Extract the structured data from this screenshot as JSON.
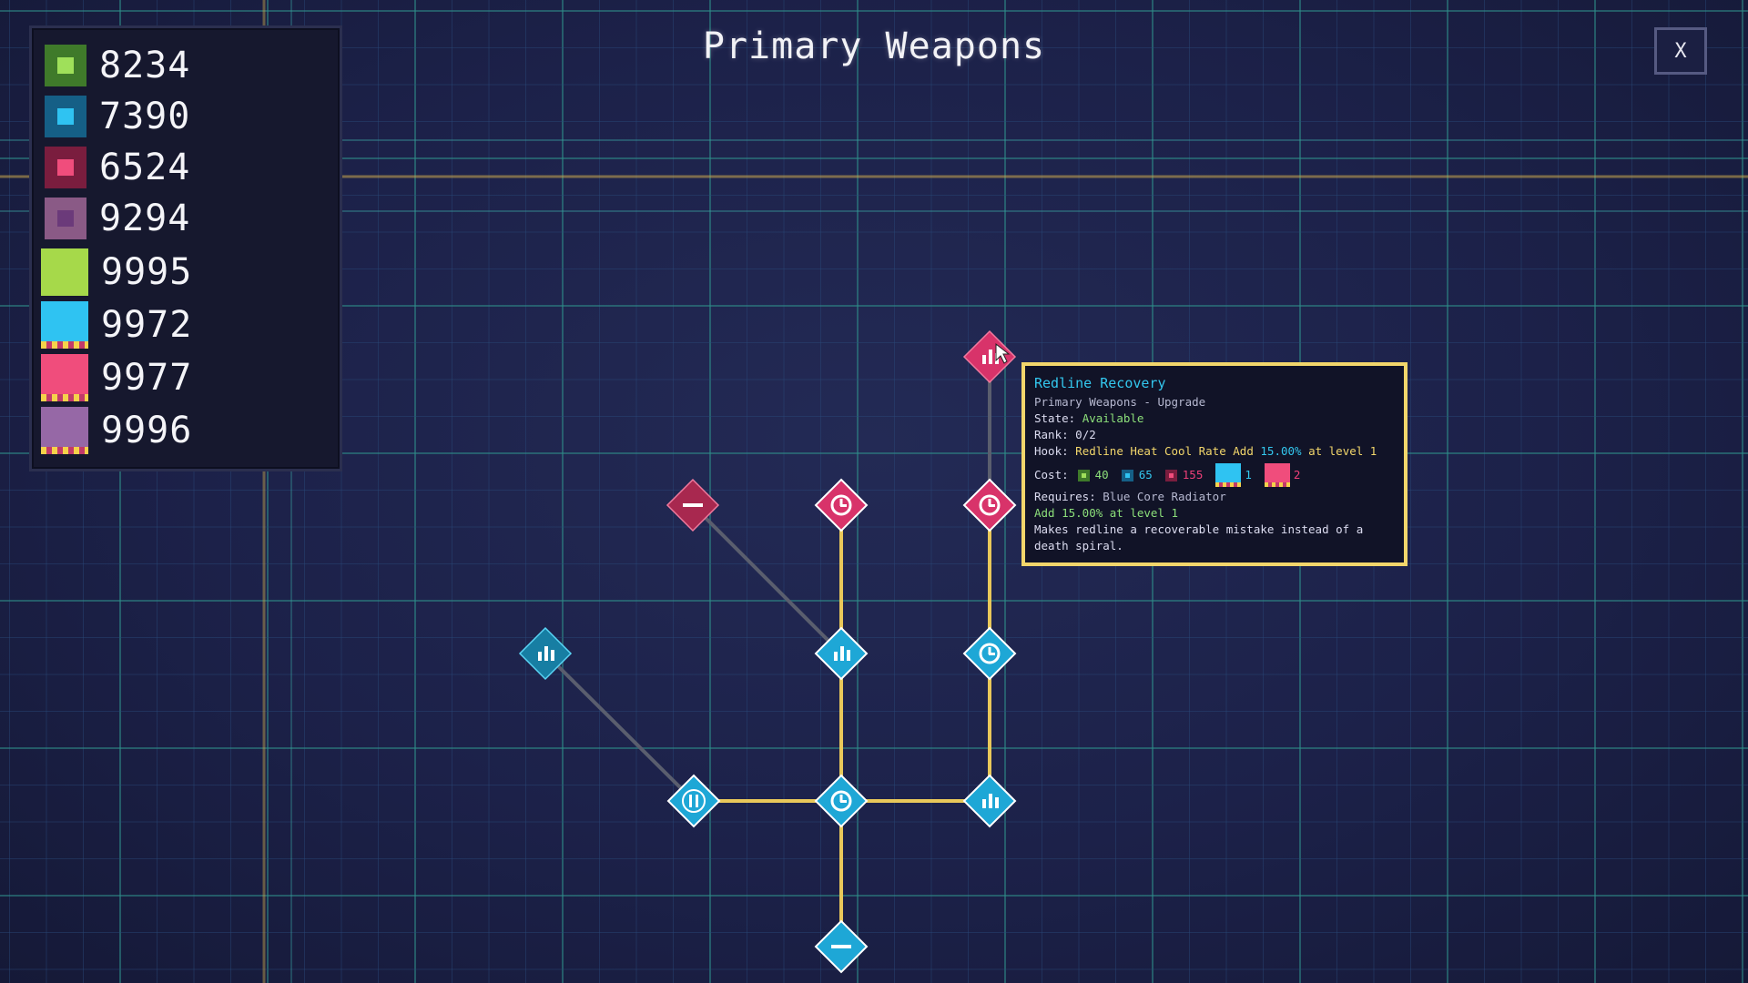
{
  "screen": {
    "title": "Primary Weapons",
    "close_label": "X"
  },
  "colors": {
    "cyan": "#1ea7d6",
    "pink": "#d8336a",
    "gold_link": "#e9c85a",
    "gray_link": "#5a5e6e",
    "tooltip_border": "#f2d66b"
  },
  "resources": [
    {
      "name": "green-shard",
      "icon": "small-green-cube",
      "value": "8234",
      "color": "#7bc043"
    },
    {
      "name": "blue-shard",
      "icon": "small-blue-cube",
      "value": "7390",
      "color": "#1ea7d6"
    },
    {
      "name": "red-shard",
      "icon": "small-red-cube",
      "value": "6524",
      "color": "#d8336a"
    },
    {
      "name": "purple-shard",
      "icon": "small-purple-cube",
      "value": "9294",
      "color": "#a86aa8"
    },
    {
      "name": "green-core",
      "icon": "large-green-core",
      "value": "9995",
      "color": "#a6d94a"
    },
    {
      "name": "blue-core",
      "icon": "large-blue-core",
      "value": "9972",
      "color": "#2fc3f2"
    },
    {
      "name": "red-core",
      "icon": "large-red-core",
      "value": "9977",
      "color": "#f04d7c"
    },
    {
      "name": "purple-core",
      "icon": "large-purple-core",
      "value": "9996",
      "color": "#9668a6"
    }
  ],
  "nodes": [
    {
      "id": "n-top-pink",
      "color": "pink",
      "glyph": "bars-icon",
      "state": "available"
    },
    {
      "id": "n-pink-left",
      "color": "pink",
      "glyph": "minus-icon",
      "state": "locked"
    },
    {
      "id": "n-pink-mid",
      "color": "pink",
      "glyph": "clock-icon",
      "state": "owned"
    },
    {
      "id": "n-pink-right",
      "color": "pink",
      "glyph": "clock-icon",
      "state": "owned"
    },
    {
      "id": "n-cyan-far-left",
      "color": "cyan",
      "glyph": "bars-icon",
      "state": "locked"
    },
    {
      "id": "n-cyan-mid",
      "color": "cyan",
      "glyph": "bars-icon",
      "state": "owned"
    },
    {
      "id": "n-cyan-right",
      "color": "cyan",
      "glyph": "clock-icon",
      "state": "owned"
    },
    {
      "id": "n-cyan-bottom-left",
      "color": "cyan",
      "glyph": "pause-icon",
      "state": "owned"
    },
    {
      "id": "n-cyan-center",
      "color": "cyan",
      "glyph": "clock-icon",
      "state": "owned"
    },
    {
      "id": "n-cyan-bottom-right",
      "color": "cyan",
      "glyph": "bars-icon",
      "state": "owned"
    },
    {
      "id": "n-cyan-bottom",
      "color": "cyan",
      "glyph": "minus-icon",
      "state": "owned"
    }
  ],
  "tooltip": {
    "title": "Redline Recovery",
    "subtitle": "Primary Weapons - Upgrade",
    "state_label": "State:",
    "state_value": "Available",
    "rank_label": "Rank:",
    "rank_value": "0/2",
    "hook_label": "Hook:",
    "hook_name": "Redline Heat Cool Rate",
    "hook_add": "Add",
    "hook_amount": "15.00%",
    "hook_level": "at level 1",
    "cost_label": "Cost:",
    "costs": [
      {
        "icon": "green-shard-icon",
        "value": "40"
      },
      {
        "icon": "blue-shard-icon",
        "value": "65"
      },
      {
        "icon": "red-shard-icon",
        "value": "155"
      },
      {
        "icon": "blue-core-icon",
        "value": "1"
      },
      {
        "icon": "red-core-icon",
        "value": "2"
      }
    ],
    "requires_label": "Requires:",
    "requires_value": "Blue Core Radiator",
    "effect": "Add 15.00% at level 1",
    "description": "Makes redline a recoverable mistake instead of a death spiral."
  }
}
